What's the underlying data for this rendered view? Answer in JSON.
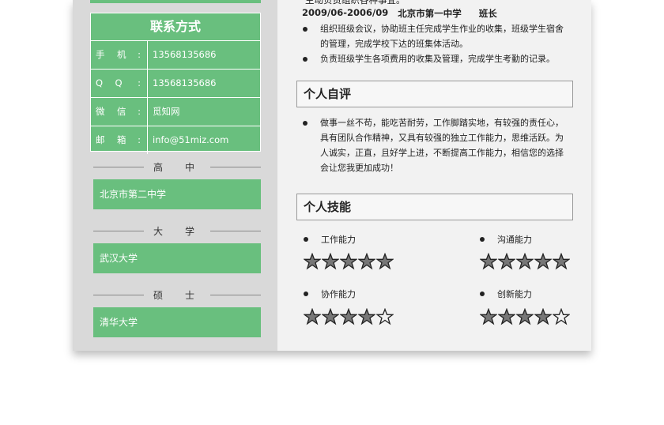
{
  "contact": {
    "title": "联系方式",
    "rows": [
      {
        "label": "手　机",
        "sep": ":",
        "value": "13568135686"
      },
      {
        "label": "Q　Q",
        "sep": ":",
        "value": "13568135686"
      },
      {
        "label": "微　信",
        "sep": ":",
        "value": "觅知网"
      },
      {
        "label": "邮　箱",
        "sep": ":",
        "value": "info@51miz.com"
      }
    ]
  },
  "education": [
    {
      "label": "高　中",
      "school": "北京市第二中学"
    },
    {
      "label": "大　学",
      "school": "武汉大学"
    },
    {
      "label": "硕　士",
      "school": "清华大学"
    }
  ],
  "experience": {
    "clipped_line": "主动负责组织各种事宜。",
    "period": "2009/06-2006/09",
    "org": "北京市第一中学",
    "role": "班长",
    "bullets": [
      "组织班级会议，协助班主任完成学生作业的收集，班级学生宿舍的管理，完成学校下达的班集体活动。",
      "负责班级学生各项费用的收集及管理，完成学生考勤的记录。"
    ]
  },
  "self_eval": {
    "title": "个人自评",
    "text": "做事一丝不苟，能吃苦耐劳，工作脚踏实地，有较强的责任心，具有团队合作精神，又具有较强的独立工作能力，思维活跃。为人诚实，正直，且好学上进，不断提高工作能力，相信您的选择会让您我更加成功！"
  },
  "skills": {
    "title": "个人技能",
    "items": [
      {
        "name": "工作能力",
        "rating": 5,
        "max": 5
      },
      {
        "name": "沟通能力",
        "rating": 5,
        "max": 5
      },
      {
        "name": "协作能力",
        "rating": 4,
        "max": 5
      },
      {
        "name": "创新能力",
        "rating": 4,
        "max": 5
      }
    ]
  },
  "colors": {
    "accent": "#69bf7e",
    "star_fill": "#777777",
    "star_outline": "#222222"
  }
}
